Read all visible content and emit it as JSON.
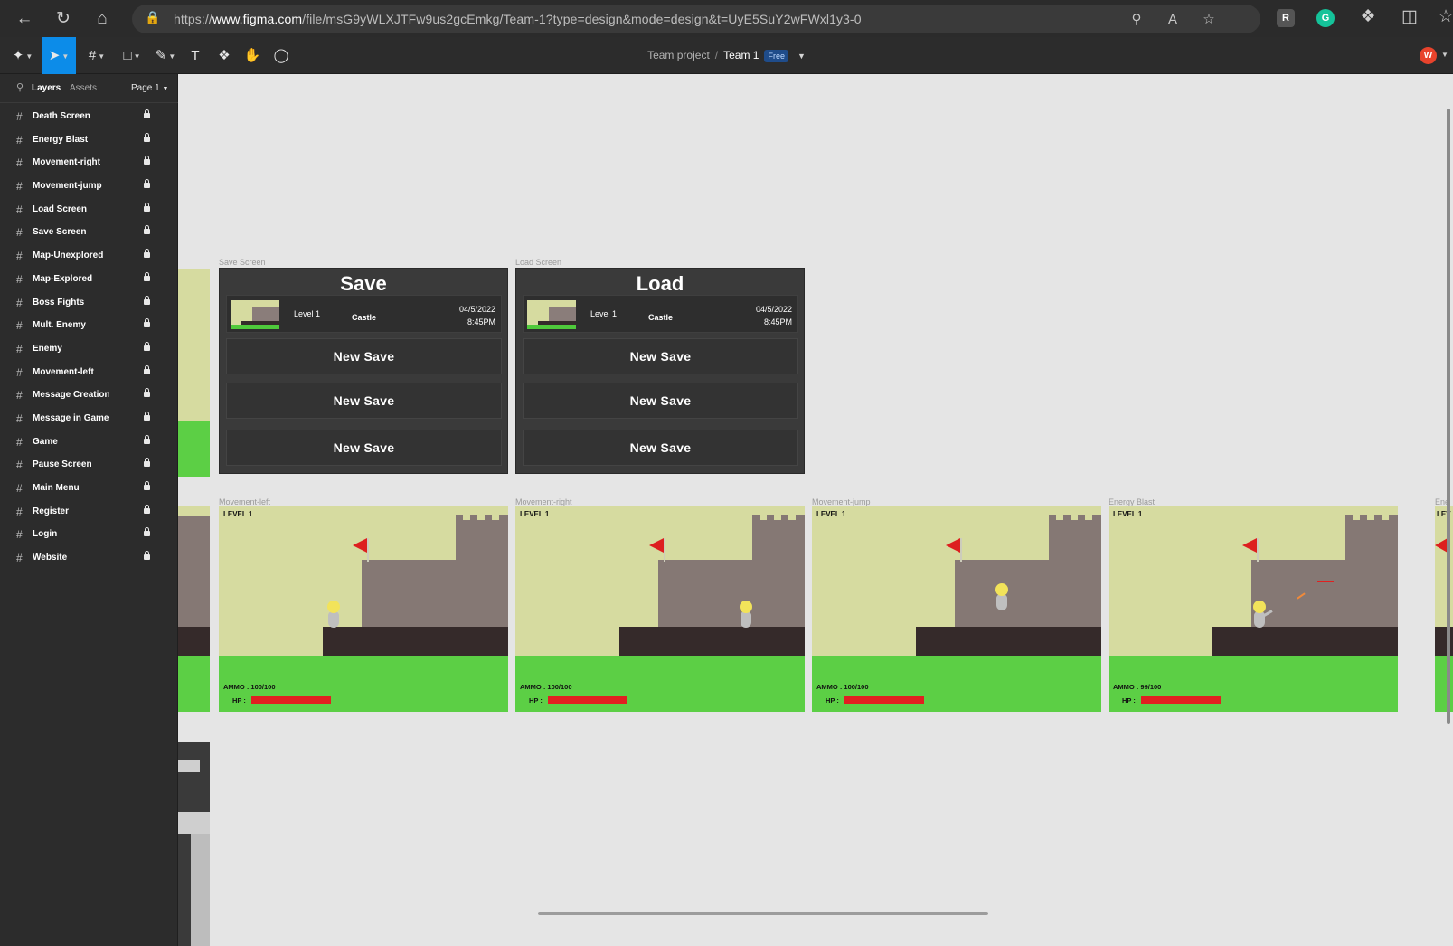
{
  "browser": {
    "url_prefix": "https://",
    "url_domain": "www.figma.com",
    "url_rest": "/file/msG9yWLXJTFw9us2gcEmkg/Team-1?type=design&mode=design&t=UyE5SuY2wFWxl1y3-0"
  },
  "toolbar": {
    "project": "Team project",
    "separator": "/",
    "team": "Team 1",
    "plan_badge": "Free",
    "avatar_letter": "W"
  },
  "left_panel": {
    "tabs": {
      "layers": "Layers",
      "assets": "Assets"
    },
    "page": "Page 1",
    "layers": [
      "Death Screen",
      "Energy Blast",
      "Movement-right",
      "Movement-jump",
      "Load Screen",
      "Save Screen",
      "Map-Unexplored",
      "Map-Explored",
      "Boss Fights",
      "Mult. Enemy",
      "Enemy",
      "Movement-left",
      "Message Creation",
      "Message in Game",
      "Game",
      "Pause Screen",
      "Main Menu",
      "Register",
      "Login",
      "Website"
    ]
  },
  "canvas": {
    "save_frame": {
      "label": "Save Screen",
      "title": "Save",
      "slot": {
        "level": "Level 1",
        "place": "Castle",
        "date": "04/5/2022",
        "time": "8:45PM"
      },
      "buttons": [
        "New Save",
        "New Save",
        "New Save"
      ]
    },
    "load_frame": {
      "label": "Load Screen",
      "title": "Load",
      "slot": {
        "level": "Level 1",
        "place": "Castle",
        "date": "04/5/2022",
        "time": "8:45PM"
      },
      "buttons": [
        "New Save",
        "New Save",
        "New Save"
      ]
    },
    "game_frames": [
      {
        "label": "Movement-left",
        "level": "LEVEL 1",
        "ammo": "AMMO : 100/100",
        "hp_label": "HP :"
      },
      {
        "label": "Movement-right",
        "level": "LEVEL 1",
        "ammo": "AMMO : 100/100",
        "hp_label": "HP :"
      },
      {
        "label": "Movement-jump",
        "level": "LEVEL 1",
        "ammo": "AMMO : 100/100",
        "hp_label": "HP :"
      },
      {
        "label": "Energy Blast",
        "level": "LEVEL 1",
        "ammo": "AMMO : 99/100",
        "hp_label": "HP :"
      }
    ],
    "partial_label": "Ene",
    "partial_level": "LEV"
  },
  "colors": {
    "accent": "#0c8ce9",
    "grass": "#5ccf45",
    "sky": "#d6dba0",
    "castle": "#857874",
    "hp": "#e02020"
  }
}
